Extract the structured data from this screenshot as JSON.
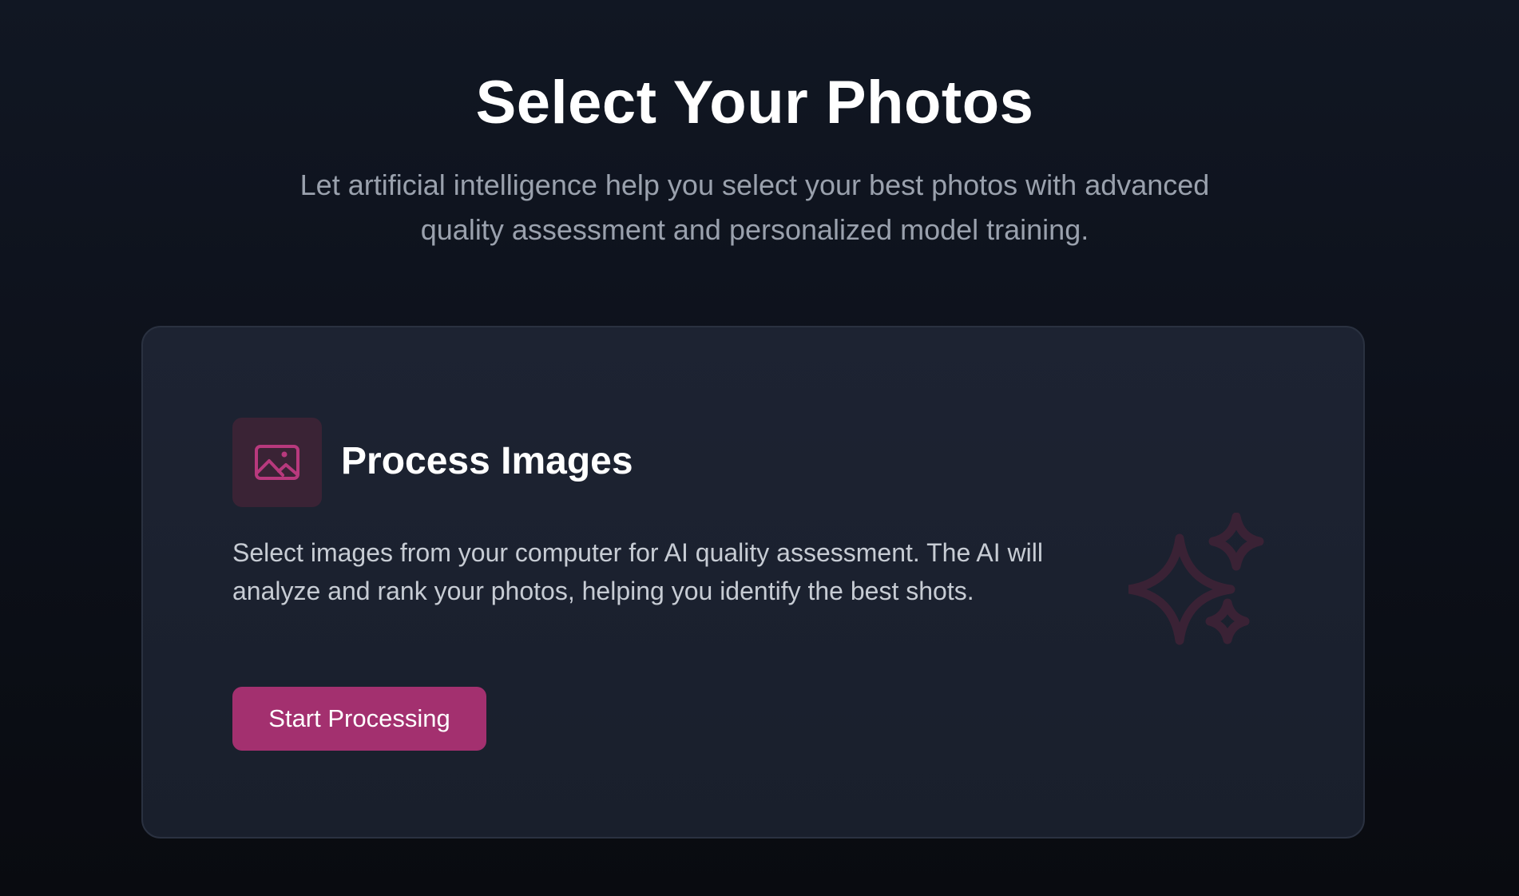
{
  "header": {
    "title": "Select Your Photos",
    "subtitle": "Let artificial intelligence help you select your best photos with advanced quality assessment and personalized model training."
  },
  "card": {
    "icon": "image-icon",
    "title": "Process Images",
    "description": "Select images from your computer for AI quality assessment. The AI will analyze and rank your photos, helping you identify the best shots.",
    "button_label": "Start Processing",
    "decoration_icon": "sparkles-icon"
  },
  "colors": {
    "accent": "#a3306f",
    "icon_bg": "#3a2335",
    "card_bg": "#1d2332",
    "page_bg": "#111723"
  }
}
